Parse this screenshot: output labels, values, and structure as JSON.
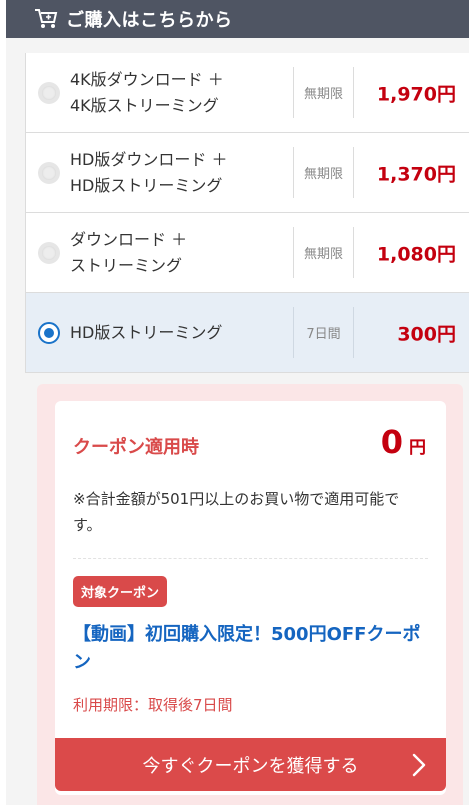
{
  "header": {
    "title": "ご購入はこちらから",
    "icon": "cart-icon"
  },
  "options": [
    {
      "line1": "4K版ダウンロード ＋",
      "line2": "4K版ストリーミング",
      "term": "無期限",
      "price": "1,970円",
      "selected": false
    },
    {
      "line1": "HD版ダウンロード ＋",
      "line2": "HD版ストリーミング",
      "term": "無期限",
      "price": "1,370円",
      "selected": false
    },
    {
      "line1": "ダウンロード ＋",
      "line2": "ストリーミング",
      "term": "無期限",
      "price": "1,080円",
      "selected": false
    },
    {
      "line1": "HD版ストリーミング",
      "line2": "",
      "term": "7日間",
      "price": "300円",
      "selected": true
    }
  ],
  "coupon": {
    "title": "クーポン適用時",
    "price_value": "0",
    "price_unit": "円",
    "note": "※合計金額が501円以上のお買い物で適用可能です。",
    "badge": "対象クーポン",
    "name": "【動画】初回購入限定！500円OFFクーポン",
    "expiry": "利用期限：取得後7日間",
    "button_label": "今すぐクーポンを獲得する"
  },
  "colors": {
    "header_bg": "#4f5563",
    "price_red": "#c4000f",
    "coupon_red": "#db4a4a",
    "link_blue": "#1565c0",
    "selected_bg": "#e7eef6"
  }
}
